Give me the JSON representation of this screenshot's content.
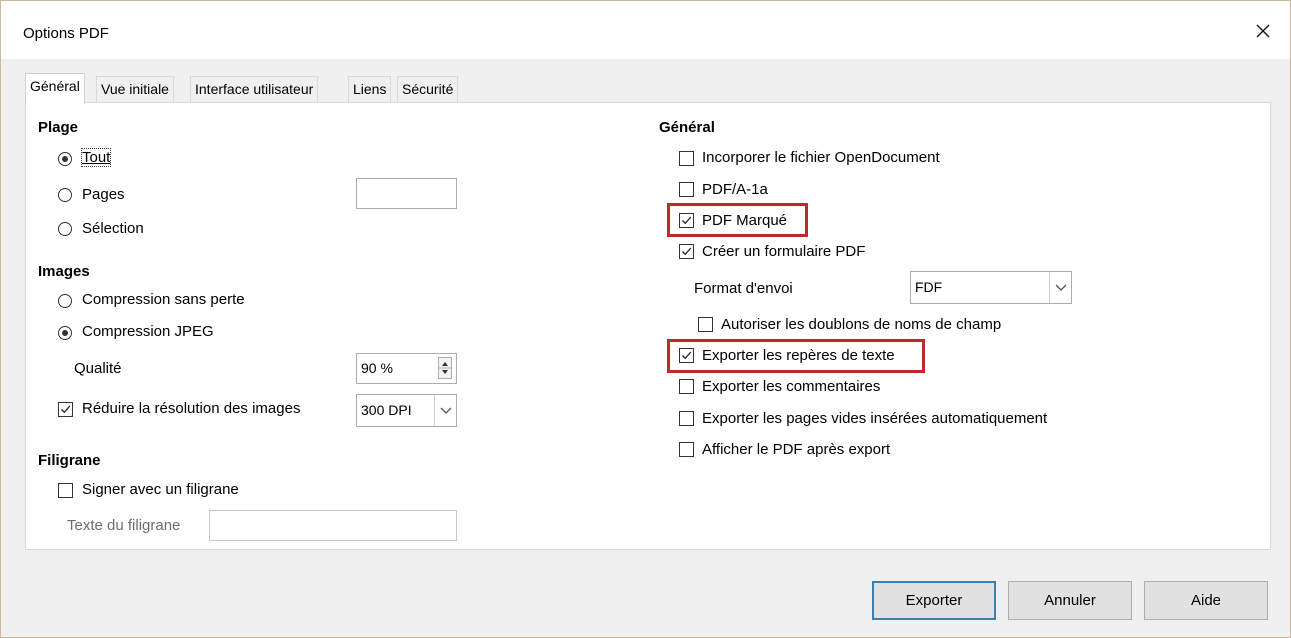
{
  "window": {
    "title": "Options PDF"
  },
  "tabs": [
    "Général",
    "Vue initiale",
    "Interface utilisateur",
    "Liens",
    "Sécurité"
  ],
  "left": {
    "plage": {
      "heading": "Plage",
      "tout": "Tout",
      "pages": "Pages",
      "selection": "Sélection",
      "pages_value": ""
    },
    "images": {
      "heading": "Images",
      "lossless": "Compression sans perte",
      "jpeg": "Compression JPEG",
      "quality_label": "Qualité",
      "quality_value": "90 %",
      "reduce_label": "Réduire la résolution des images",
      "reduce_value": "300 DPI"
    },
    "watermark": {
      "heading": "Filigrane",
      "sign_label": "Signer avec un filigrane",
      "text_label": "Texte du filigrane",
      "text_value": ""
    }
  },
  "right": {
    "heading": "Général",
    "embed_od": "Incorporer le fichier OpenDocument",
    "pdfa": "PDF/A-1a",
    "tagged": "PDF Marqué",
    "create_form": "Créer un formulaire PDF",
    "format_label": "Format d'envoi",
    "format_value": "FDF",
    "allow_dup": "Autoriser les doublons de noms de champ",
    "export_bookmarks": "Exporter les repères de texte",
    "export_comments": "Exporter les commentaires",
    "export_blank": "Exporter les pages vides insérées automatiquement",
    "view_after": "Afficher le PDF après export"
  },
  "state": {
    "range": "tout",
    "image_compression": "jpeg",
    "reduce_resolution": true,
    "sign_watermark": false,
    "embed_od": false,
    "pdfa": false,
    "tagged": true,
    "create_form": true,
    "allow_dup": false,
    "export_bookmarks": true,
    "export_comments": false,
    "export_blank": false,
    "view_after": false
  },
  "buttons": {
    "export": "Exporter",
    "cancel": "Annuler",
    "help": "Aide"
  },
  "colors": {
    "highlight": "#c1272d",
    "default_button_border": "#3c7fb1"
  }
}
